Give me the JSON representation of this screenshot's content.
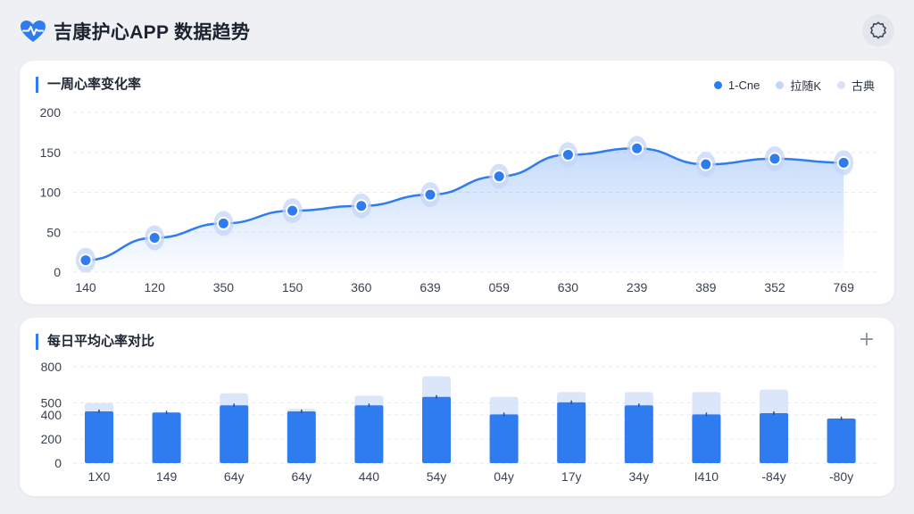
{
  "app": {
    "title": "吉康护心APP 数据趋势",
    "logo_icon": "heart-pulse-icon",
    "settings_icon": "gear-icon",
    "accent_color": "#2f7cf0"
  },
  "line_card": {
    "title": "一周心率变化率",
    "legend": [
      {
        "label": "1-Cne",
        "color": "#2f7cf0"
      },
      {
        "label": "拉随K",
        "color": "#c3d6f8"
      },
      {
        "label": "古典",
        "color": "#d7e2f4"
      }
    ]
  },
  "bar_card": {
    "title": "每日平均心率对比",
    "add_icon": "plus-icon",
    "add_symbol": "+"
  },
  "chart_data": [
    {
      "type": "line",
      "title": "一周心率变化率",
      "categories": [
        "140",
        "120",
        "350",
        "150",
        "360",
        "639",
        "059",
        "630",
        "239",
        "389",
        "352",
        "769"
      ],
      "series": [
        {
          "name": "1-Cne",
          "values": [
            15,
            43,
            61,
            77,
            83,
            97,
            120,
            147,
            155,
            135,
            142,
            137
          ]
        }
      ],
      "yticks": [
        0,
        50,
        100,
        150,
        200
      ],
      "ylim": [
        0,
        200
      ],
      "area_fill": true,
      "grid": true
    },
    {
      "type": "bar",
      "title": "每日平均心率对比",
      "categories": [
        "1X0",
        "149",
        "64y",
        "64y",
        "440",
        "54y",
        "04y",
        "17y",
        "34y",
        "I410",
        "-84y",
        "-80y"
      ],
      "series": [
        {
          "values": [
            430,
            420,
            480,
            430,
            480,
            550,
            405,
            505,
            480,
            405,
            415,
            370
          ]
        },
        {
          "values": [
            500,
            420,
            580,
            450,
            560,
            720,
            550,
            590,
            590,
            590,
            610,
            370
          ]
        }
      ],
      "yticks": [
        0,
        200,
        400,
        500,
        800
      ],
      "ylim": [
        0,
        800
      ],
      "grid": true
    }
  ]
}
